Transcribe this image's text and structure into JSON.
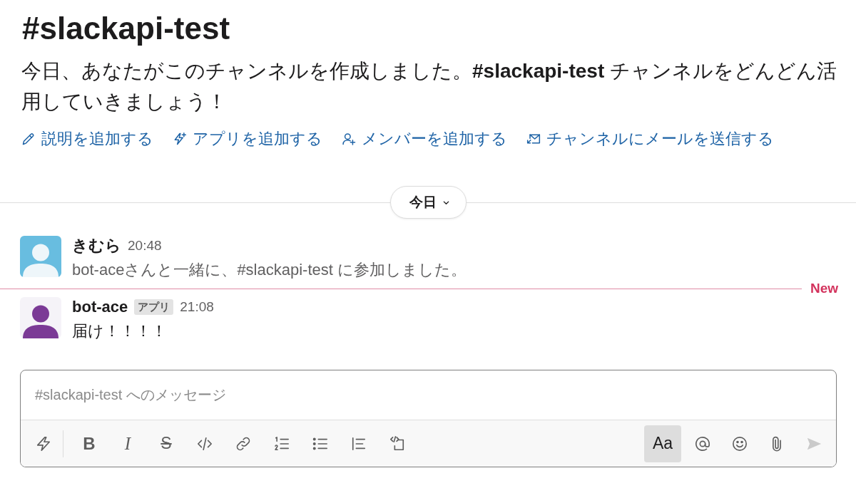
{
  "channel": {
    "title": "#slackapi-test",
    "intro": "今日、あなたがこのチャンネルを作成しました。**#slackapi-test** チャンネルをどんどん活用していきましょう！"
  },
  "actions": [
    {
      "kind": "edit",
      "label": "説明を追加する"
    },
    {
      "kind": "app",
      "label": "アプリを追加する"
    },
    {
      "kind": "member",
      "label": "メンバーを追加する"
    },
    {
      "kind": "email",
      "label": "チャンネルにメールを送信する"
    }
  ],
  "date_divider": {
    "label": "今日"
  },
  "feed": [
    {
      "kind": "join",
      "author": "きむら",
      "time": "20:48",
      "text": "bot-aceさんと一緒に、#slackapi-test に参加しました。",
      "avatar": {
        "kind": "tile",
        "color": "#68bde0"
      }
    },
    {
      "kind": "new_divider",
      "label": "New"
    },
    {
      "kind": "post",
      "author": "bot-ace",
      "badge": "アプリ",
      "time": "21:08",
      "text": "届け！！！！",
      "avatar": {
        "kind": "figure",
        "color": "#7b3a96"
      }
    }
  ],
  "composer": {
    "placeholder": "#slackapi-test へのメッセージ",
    "tools": [
      {
        "kind": "shortcuts"
      },
      {
        "kind": "bold",
        "label": "B"
      },
      {
        "kind": "italic",
        "label": "I"
      },
      {
        "kind": "strike",
        "label": "S"
      },
      {
        "kind": "code"
      },
      {
        "kind": "link"
      },
      {
        "kind": "ordered_list"
      },
      {
        "kind": "bullet_list"
      },
      {
        "kind": "quote"
      },
      {
        "kind": "code_block"
      }
    ],
    "actions": [
      {
        "kind": "format",
        "label": "Aa",
        "selected": true,
        "disabled": false
      },
      {
        "kind": "mention",
        "selected": false,
        "disabled": false
      },
      {
        "kind": "emoji",
        "selected": false,
        "disabled": false
      },
      {
        "kind": "attach",
        "selected": false,
        "disabled": false
      },
      {
        "kind": "send",
        "selected": false,
        "disabled": true
      }
    ]
  }
}
